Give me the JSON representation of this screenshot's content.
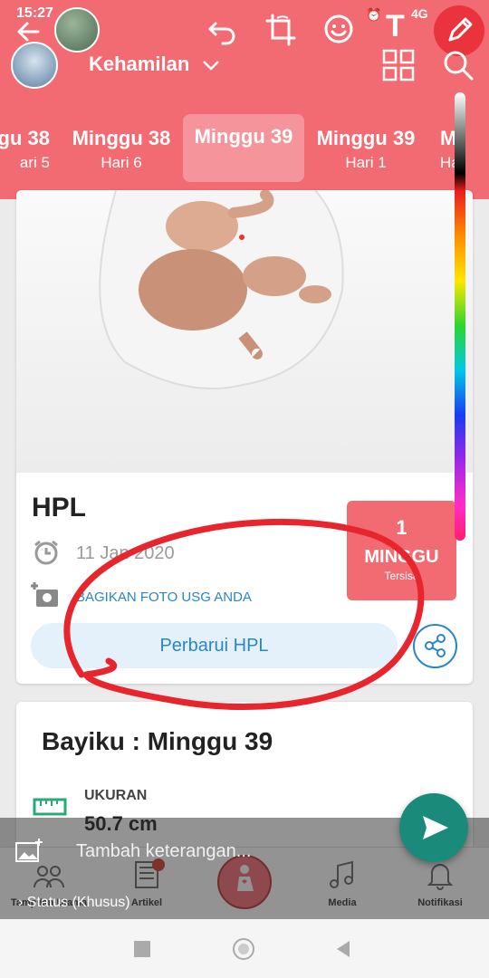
{
  "status_bar": {
    "time": "15:27",
    "network": "4G"
  },
  "editor": {
    "text_tool": "T"
  },
  "header": {
    "title": "Kehamilan"
  },
  "tabs": [
    {
      "week": "gu 38",
      "day": "ari 5"
    },
    {
      "week": "Minggu 38",
      "day": "Hari 6"
    },
    {
      "week": "Minggu 39",
      "day": ""
    },
    {
      "week": "Minggu 39",
      "day": "Hari 1"
    },
    {
      "week": "Mi",
      "day": "Ha"
    }
  ],
  "hpl": {
    "title": "HPL",
    "date": "11 Jan 2020",
    "share_usg": "BAGIKAN FOTO USG ANDA",
    "update_button": "Perbarui HPL",
    "countdown_number": "1",
    "countdown_unit": "MINGGU",
    "countdown_label": "Tersisa"
  },
  "baby": {
    "title": "Bayiku :  Minggu 39",
    "size_label": "UKURAN",
    "size_value": "50.7 cm"
  },
  "caption": {
    "placeholder": "Tambah keterangan...",
    "status_label": "Status (Khusus)"
  },
  "nav": [
    {
      "label": "Tampilan Utama"
    },
    {
      "label": "Artikel"
    },
    {
      "label": ""
    },
    {
      "label": "Media"
    },
    {
      "label": "Notifikasi"
    }
  ],
  "colors": {
    "brand": "#f26b73",
    "accent_blue": "#2a86c8",
    "fab_green": "#1a8a7a",
    "annotation_red": "#e8252d"
  }
}
